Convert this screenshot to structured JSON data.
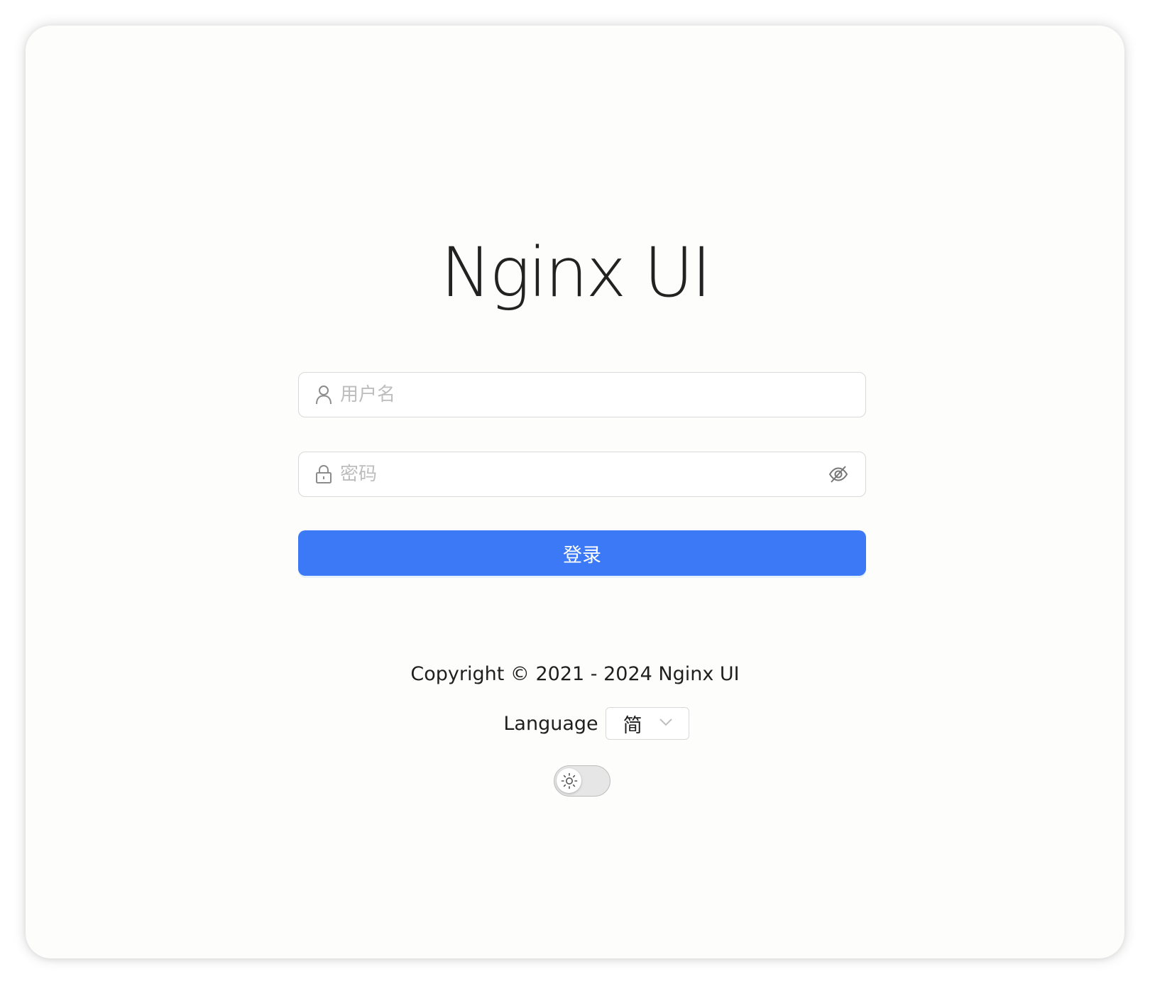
{
  "app": {
    "title": "Nginx UI"
  },
  "login": {
    "username_placeholder": "用户名",
    "password_placeholder": "密码",
    "submit_label": "登录"
  },
  "footer": {
    "copyright": "Copyright © 2021 - 2024 Nginx UI",
    "language_label": "Language",
    "language_selected": "简"
  },
  "theme": {
    "mode": "light"
  },
  "icons": {
    "username": "user-icon",
    "password": "lock-icon",
    "password_toggle": "eye-invisible-icon",
    "language_dropdown": "chevron-down-icon",
    "theme": "sun-icon"
  },
  "colors": {
    "primary": "#3b79f6",
    "border": "#d9d9d9",
    "placeholder": "#bdbdbd",
    "text": "#1f1f1f"
  }
}
